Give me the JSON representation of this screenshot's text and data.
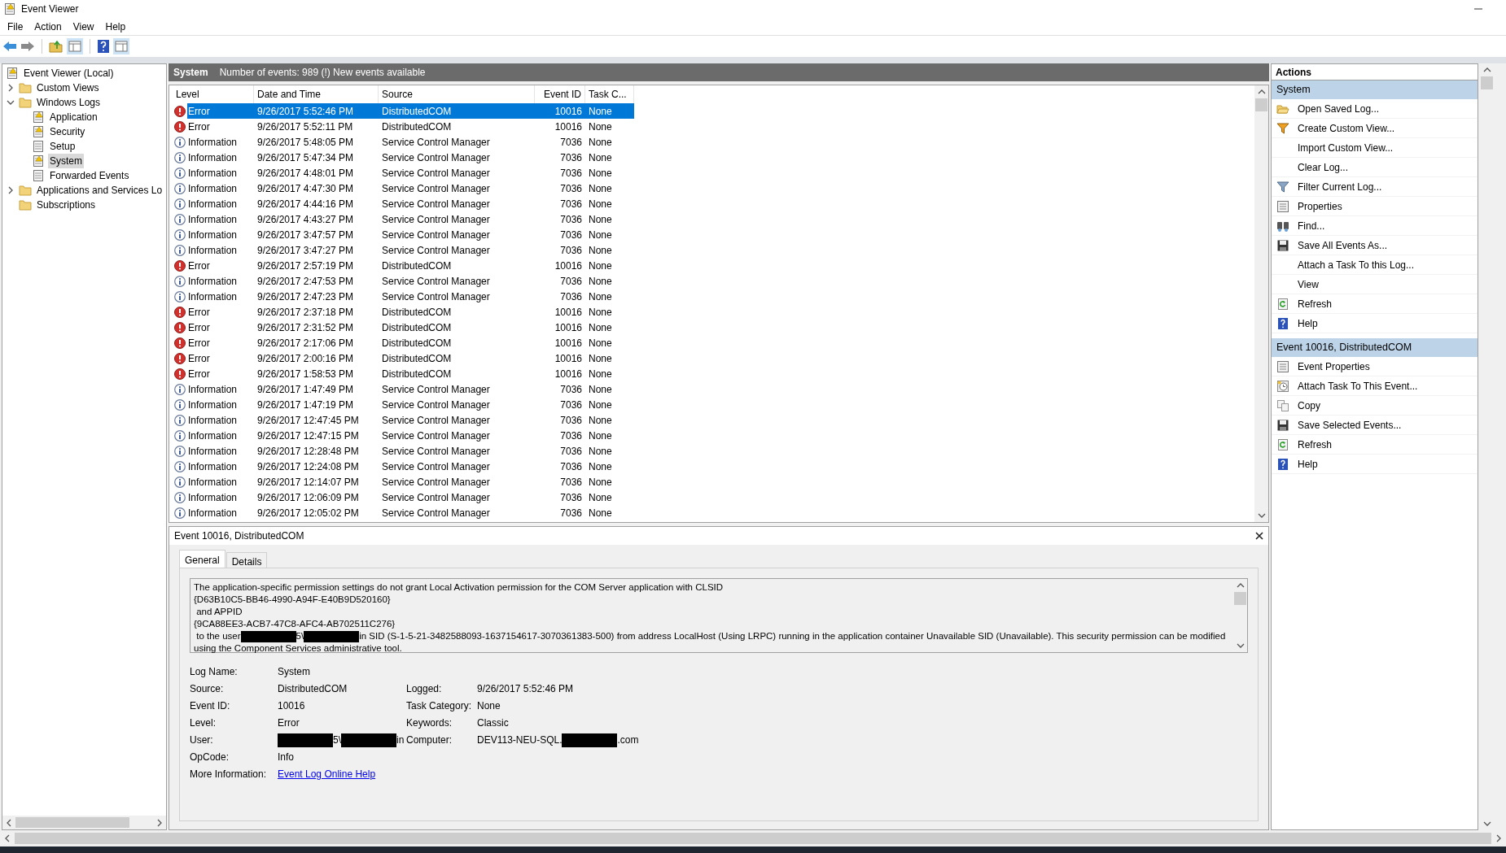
{
  "window": {
    "title": "Event Viewer"
  },
  "menu": [
    "File",
    "Action",
    "View",
    "Help"
  ],
  "tree": [
    {
      "label": "Event Viewer (Local)",
      "kind": "root",
      "selected": false,
      "children": [
        {
          "label": "Custom Views",
          "kind": "folder",
          "expanded": false,
          "selected": false
        },
        {
          "label": "Windows Logs",
          "kind": "folder",
          "expanded": true,
          "selected": false,
          "children": [
            {
              "label": "Application",
              "kind": "log",
              "selected": false
            },
            {
              "label": "Security",
              "kind": "log",
              "selected": false
            },
            {
              "label": "Setup",
              "kind": "plainlog",
              "selected": false
            },
            {
              "label": "System",
              "kind": "log",
              "selected": true
            },
            {
              "label": "Forwarded Events",
              "kind": "plainlog",
              "selected": false
            }
          ]
        },
        {
          "label": "Applications and Services Lo",
          "kind": "folder",
          "expanded": false,
          "selected": false
        },
        {
          "label": "Subscriptions",
          "kind": "folder",
          "selected": false
        }
      ]
    }
  ],
  "log_header": {
    "title": "System",
    "info": "Number of events: 989 (!) New events available"
  },
  "table": {
    "columns": [
      "Level",
      "Date and Time",
      "Source",
      "Event ID",
      "Task C..."
    ],
    "rows": [
      {
        "kind": "error",
        "level": "Error",
        "date": "9/26/2017 5:52:46 PM",
        "source": "DistributedCOM",
        "event_id": "10016",
        "task": "None",
        "selected": true
      },
      {
        "kind": "error",
        "level": "Error",
        "date": "9/26/2017 5:52:11 PM",
        "source": "DistributedCOM",
        "event_id": "10016",
        "task": "None",
        "selected": false
      },
      {
        "kind": "information",
        "level": "Information",
        "date": "9/26/2017 5:48:05 PM",
        "source": "Service Control Manager",
        "event_id": "7036",
        "task": "None",
        "selected": false
      },
      {
        "kind": "information",
        "level": "Information",
        "date": "9/26/2017 5:47:34 PM",
        "source": "Service Control Manager",
        "event_id": "7036",
        "task": "None",
        "selected": false
      },
      {
        "kind": "information",
        "level": "Information",
        "date": "9/26/2017 4:48:01 PM",
        "source": "Service Control Manager",
        "event_id": "7036",
        "task": "None",
        "selected": false
      },
      {
        "kind": "information",
        "level": "Information",
        "date": "9/26/2017 4:47:30 PM",
        "source": "Service Control Manager",
        "event_id": "7036",
        "task": "None",
        "selected": false
      },
      {
        "kind": "information",
        "level": "Information",
        "date": "9/26/2017 4:44:16 PM",
        "source": "Service Control Manager",
        "event_id": "7036",
        "task": "None",
        "selected": false
      },
      {
        "kind": "information",
        "level": "Information",
        "date": "9/26/2017 4:43:27 PM",
        "source": "Service Control Manager",
        "event_id": "7036",
        "task": "None",
        "selected": false
      },
      {
        "kind": "information",
        "level": "Information",
        "date": "9/26/2017 3:47:57 PM",
        "source": "Service Control Manager",
        "event_id": "7036",
        "task": "None",
        "selected": false
      },
      {
        "kind": "information",
        "level": "Information",
        "date": "9/26/2017 3:47:27 PM",
        "source": "Service Control Manager",
        "event_id": "7036",
        "task": "None",
        "selected": false
      },
      {
        "kind": "error",
        "level": "Error",
        "date": "9/26/2017 2:57:19 PM",
        "source": "DistributedCOM",
        "event_id": "10016",
        "task": "None",
        "selected": false
      },
      {
        "kind": "information",
        "level": "Information",
        "date": "9/26/2017 2:47:53 PM",
        "source": "Service Control Manager",
        "event_id": "7036",
        "task": "None",
        "selected": false
      },
      {
        "kind": "information",
        "level": "Information",
        "date": "9/26/2017 2:47:23 PM",
        "source": "Service Control Manager",
        "event_id": "7036",
        "task": "None",
        "selected": false
      },
      {
        "kind": "error",
        "level": "Error",
        "date": "9/26/2017 2:37:18 PM",
        "source": "DistributedCOM",
        "event_id": "10016",
        "task": "None",
        "selected": false
      },
      {
        "kind": "error",
        "level": "Error",
        "date": "9/26/2017 2:31:52 PM",
        "source": "DistributedCOM",
        "event_id": "10016",
        "task": "None",
        "selected": false
      },
      {
        "kind": "error",
        "level": "Error",
        "date": "9/26/2017 2:17:06 PM",
        "source": "DistributedCOM",
        "event_id": "10016",
        "task": "None",
        "selected": false
      },
      {
        "kind": "error",
        "level": "Error",
        "date": "9/26/2017 2:00:16 PM",
        "source": "DistributedCOM",
        "event_id": "10016",
        "task": "None",
        "selected": false
      },
      {
        "kind": "error",
        "level": "Error",
        "date": "9/26/2017 1:58:53 PM",
        "source": "DistributedCOM",
        "event_id": "10016",
        "task": "None",
        "selected": false
      },
      {
        "kind": "information",
        "level": "Information",
        "date": "9/26/2017 1:47:49 PM",
        "source": "Service Control Manager",
        "event_id": "7036",
        "task": "None",
        "selected": false
      },
      {
        "kind": "information",
        "level": "Information",
        "date": "9/26/2017 1:47:19 PM",
        "source": "Service Control Manager",
        "event_id": "7036",
        "task": "None",
        "selected": false
      },
      {
        "kind": "information",
        "level": "Information",
        "date": "9/26/2017 12:47:45 PM",
        "source": "Service Control Manager",
        "event_id": "7036",
        "task": "None",
        "selected": false
      },
      {
        "kind": "information",
        "level": "Information",
        "date": "9/26/2017 12:47:15 PM",
        "source": "Service Control Manager",
        "event_id": "7036",
        "task": "None",
        "selected": false
      },
      {
        "kind": "information",
        "level": "Information",
        "date": "9/26/2017 12:28:48 PM",
        "source": "Service Control Manager",
        "event_id": "7036",
        "task": "None",
        "selected": false
      },
      {
        "kind": "information",
        "level": "Information",
        "date": "9/26/2017 12:24:08 PM",
        "source": "Service Control Manager",
        "event_id": "7036",
        "task": "None",
        "selected": false
      },
      {
        "kind": "information",
        "level": "Information",
        "date": "9/26/2017 12:14:07 PM",
        "source": "Service Control Manager",
        "event_id": "7036",
        "task": "None",
        "selected": false
      },
      {
        "kind": "information",
        "level": "Information",
        "date": "9/26/2017 12:06:09 PM",
        "source": "Service Control Manager",
        "event_id": "7036",
        "task": "None",
        "selected": false
      },
      {
        "kind": "information",
        "level": "Information",
        "date": "9/26/2017 12:05:02 PM",
        "source": "Service Control Manager",
        "event_id": "7036",
        "task": "None",
        "selected": false
      }
    ]
  },
  "details": {
    "title": "Event 10016, DistributedCOM",
    "tabs": [
      {
        "label": "General",
        "selected": true
      },
      {
        "label": "Details",
        "selected": false
      }
    ],
    "message": [
      [
        {
          "kind": "text",
          "text": "The application-specific permission settings do not grant Local Activation permission for the COM Server application with CLSID"
        }
      ],
      [
        {
          "kind": "text",
          "text": "{D63B10C5-BB46-4990-A94F-E40B9D520160}"
        }
      ],
      [
        {
          "kind": "text",
          "text": " and APPID"
        }
      ],
      [
        {
          "kind": "text",
          "text": "{9CA88EE3-ACB7-47C8-AFC4-AB702511C276}"
        }
      ],
      [
        {
          "kind": "text",
          "text": " to the user"
        },
        {
          "kind": "redacted"
        },
        {
          "kind": "text",
          "text": "5\\"
        },
        {
          "kind": "redacted"
        },
        {
          "kind": "text",
          "text": "in SID (S-1-5-21-3482588093-1637154617-3070361383-500) from address LocalHost (Using LRPC) running in the application container Unavailable SID (Unavailable). This security permission can be modified"
        }
      ],
      [
        {
          "kind": "text",
          "text": "using the Component Services administrative tool."
        }
      ]
    ],
    "fields": [
      {
        "label": "Log Name:",
        "value": [
          {
            "kind": "text",
            "text": "System"
          }
        ]
      },
      {
        "label": "Source:",
        "value": [
          {
            "kind": "text",
            "text": "DistributedCOM"
          }
        ],
        "label2": "Logged:",
        "value2": [
          {
            "kind": "text",
            "text": "9/26/2017 5:52:46 PM"
          }
        ]
      },
      {
        "label": "Event ID:",
        "value": [
          {
            "kind": "text",
            "text": "10016"
          }
        ],
        "label2": "Task Category:",
        "value2": [
          {
            "kind": "text",
            "text": "None"
          }
        ]
      },
      {
        "label": "Level:",
        "value": [
          {
            "kind": "text",
            "text": "Error"
          }
        ],
        "label2": "Keywords:",
        "value2": [
          {
            "kind": "text",
            "text": "Classic"
          }
        ]
      },
      {
        "label": "User:",
        "value": [
          {
            "kind": "redacted"
          },
          {
            "kind": "text",
            "text": "5\\"
          },
          {
            "kind": "redacted"
          },
          {
            "kind": "text",
            "text": "in"
          }
        ],
        "label2": "Computer:",
        "value2": [
          {
            "kind": "text",
            "text": "DEV113-NEU-SQL."
          },
          {
            "kind": "redacted"
          },
          {
            "kind": "text",
            "text": ".com"
          }
        ]
      },
      {
        "label": "OpCode:",
        "value": [
          {
            "kind": "text",
            "text": "Info"
          }
        ]
      },
      {
        "label": "More Information:",
        "value": [
          {
            "kind": "link",
            "text": "Event Log Online Help"
          }
        ]
      }
    ]
  },
  "actions": {
    "title": "Actions",
    "sections": [
      {
        "title": "System",
        "items": [
          {
            "label": "Open Saved Log...",
            "kind": "folder"
          },
          {
            "label": "Create Custom View...",
            "kind": "newfilter"
          },
          {
            "label": "Import Custom View...",
            "kind": "plain"
          },
          {
            "label": "Clear Log...",
            "kind": "plain"
          },
          {
            "label": "Filter Current Log...",
            "kind": "filter"
          },
          {
            "label": "Properties",
            "kind": "properties"
          },
          {
            "label": "Find...",
            "kind": "find"
          },
          {
            "label": "Save All Events As...",
            "kind": "save"
          },
          {
            "label": "Attach a Task To this Log...",
            "kind": "plain"
          },
          {
            "label": "View",
            "kind": "plain"
          },
          {
            "label": "Refresh",
            "kind": "refresh"
          },
          {
            "label": "Help",
            "kind": "help"
          }
        ]
      },
      {
        "title": "Event 10016, DistributedCOM",
        "items": [
          {
            "label": "Event Properties",
            "kind": "properties"
          },
          {
            "label": "Attach Task To This Event...",
            "kind": "task"
          },
          {
            "label": "Copy",
            "kind": "copy"
          },
          {
            "label": "Save Selected Events...",
            "kind": "save"
          },
          {
            "label": "Refresh",
            "kind": "refresh"
          },
          {
            "label": "Help",
            "kind": "help"
          }
        ]
      }
    ]
  }
}
